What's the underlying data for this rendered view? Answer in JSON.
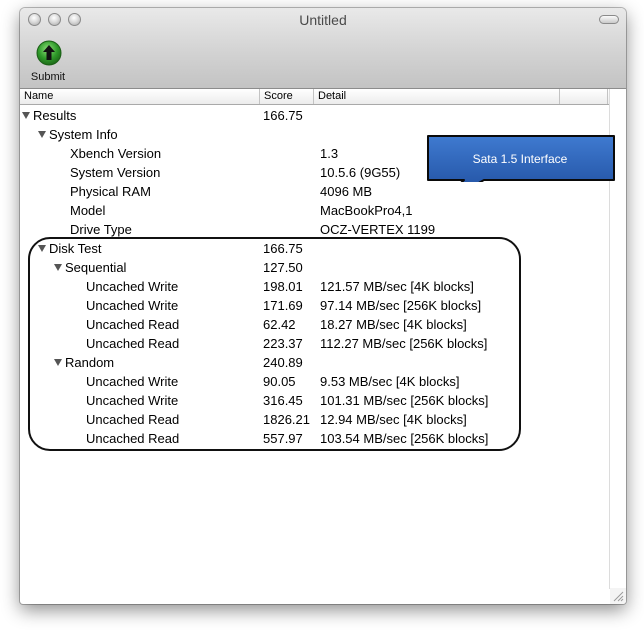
{
  "window": {
    "title": "Untitled"
  },
  "toolbar": {
    "submit_label": "Submit"
  },
  "columns": {
    "name": "Name",
    "score": "Score",
    "detail": "Detail"
  },
  "rows": [
    {
      "name": "Results",
      "score": "166.75",
      "detail": "",
      "level": 0,
      "expandable": true
    },
    {
      "name": "System Info",
      "score": "",
      "detail": "",
      "level": 1,
      "expandable": true
    },
    {
      "name": "Xbench Version",
      "score": "",
      "detail": "1.3",
      "level": 2,
      "expandable": false
    },
    {
      "name": "System Version",
      "score": "",
      "detail": "10.5.6 (9G55)",
      "level": 2,
      "expandable": false
    },
    {
      "name": "Physical RAM",
      "score": "",
      "detail": "4096 MB",
      "level": 2,
      "expandable": false
    },
    {
      "name": "Model",
      "score": "",
      "detail": "MacBookPro4,1",
      "level": 2,
      "expandable": false
    },
    {
      "name": "Drive Type",
      "score": "",
      "detail": "OCZ-VERTEX 1199",
      "level": 2,
      "expandable": false
    },
    {
      "name": "Disk Test",
      "score": "166.75",
      "detail": "",
      "level": 1,
      "expandable": true
    },
    {
      "name": "Sequential",
      "score": "127.50",
      "detail": "",
      "level": 2,
      "expandable": true
    },
    {
      "name": "Uncached Write",
      "score": "198.01",
      "detail": "121.57 MB/sec [4K blocks]",
      "level": 3,
      "expandable": false
    },
    {
      "name": "Uncached Write",
      "score": "171.69",
      "detail": "97.14 MB/sec [256K blocks]",
      "level": 3,
      "expandable": false
    },
    {
      "name": "Uncached Read",
      "score": "62.42",
      "detail": "18.27 MB/sec [4K blocks]",
      "level": 3,
      "expandable": false
    },
    {
      "name": "Uncached Read",
      "score": "223.37",
      "detail": "112.27 MB/sec [256K blocks]",
      "level": 3,
      "expandable": false
    },
    {
      "name": "Random",
      "score": "240.89",
      "detail": "",
      "level": 2,
      "expandable": true
    },
    {
      "name": "Uncached Write",
      "score": "90.05",
      "detail": "9.53 MB/sec [4K blocks]",
      "level": 3,
      "expandable": false
    },
    {
      "name": "Uncached Write",
      "score": "316.45",
      "detail": "101.31 MB/sec [256K blocks]",
      "level": 3,
      "expandable": false
    },
    {
      "name": "Uncached Read",
      "score": "1826.21",
      "detail": "12.94 MB/sec [4K blocks]",
      "level": 3,
      "expandable": false
    },
    {
      "name": "Uncached Read",
      "score": "557.97",
      "detail": "103.54 MB/sec [256K blocks]",
      "level": 3,
      "expandable": false
    }
  ],
  "annotation": {
    "callout_text": "Sata 1.5 Interface"
  },
  "colors": {
    "callout_fill": "#1f55a8",
    "submit_icon": "#2f9a2a"
  },
  "icons": {
    "submit": "green-up-arrow-icon",
    "disclosure": "disclosure-triangle-icon",
    "resize": "resize-grip-icon"
  }
}
